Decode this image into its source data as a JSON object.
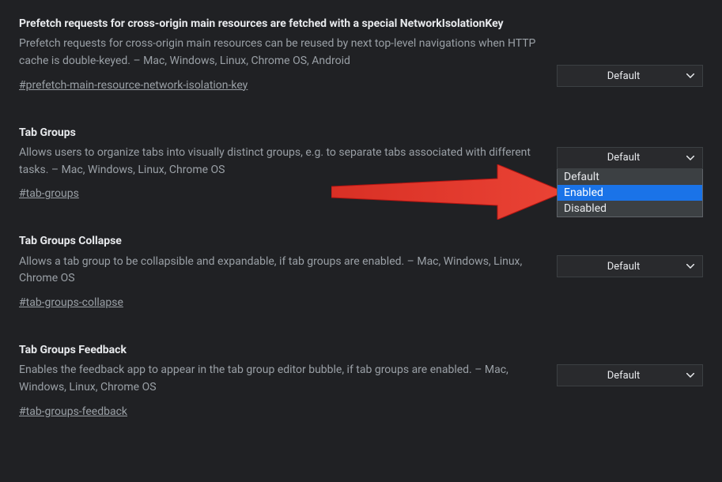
{
  "flags": [
    {
      "title": "Prefetch requests for cross-origin main resources are fetched with a special NetworkIsolationKey",
      "description": "Prefetch requests for cross-origin main resources can be reused by next top-level navigations when HTTP cache is double-keyed. – Mac, Windows, Linux, Chrome OS, Android",
      "link": "#prefetch-main-resource-network-isolation-key",
      "selected": "Default"
    },
    {
      "title": "Tab Groups",
      "description": "Allows users to organize tabs into visually distinct groups, e.g. to separate tabs associated with different tasks. – Mac, Windows, Linux, Chrome OS",
      "link": "#tab-groups",
      "selected": "Default",
      "dropdown_open": true,
      "options": [
        "Default",
        "Enabled",
        "Disabled"
      ],
      "highlighted_option": "Enabled"
    },
    {
      "title": "Tab Groups Collapse",
      "description": "Allows a tab group to be collapsible and expandable, if tab groups are enabled. – Mac, Windows, Linux, Chrome OS",
      "link": "#tab-groups-collapse",
      "selected": "Default"
    },
    {
      "title": "Tab Groups Feedback",
      "description": "Enables the feedback app to appear in the tab group editor bubble, if tab groups are enabled. – Mac, Windows, Linux, Chrome OS",
      "link": "#tab-groups-feedback",
      "selected": "Default"
    }
  ]
}
